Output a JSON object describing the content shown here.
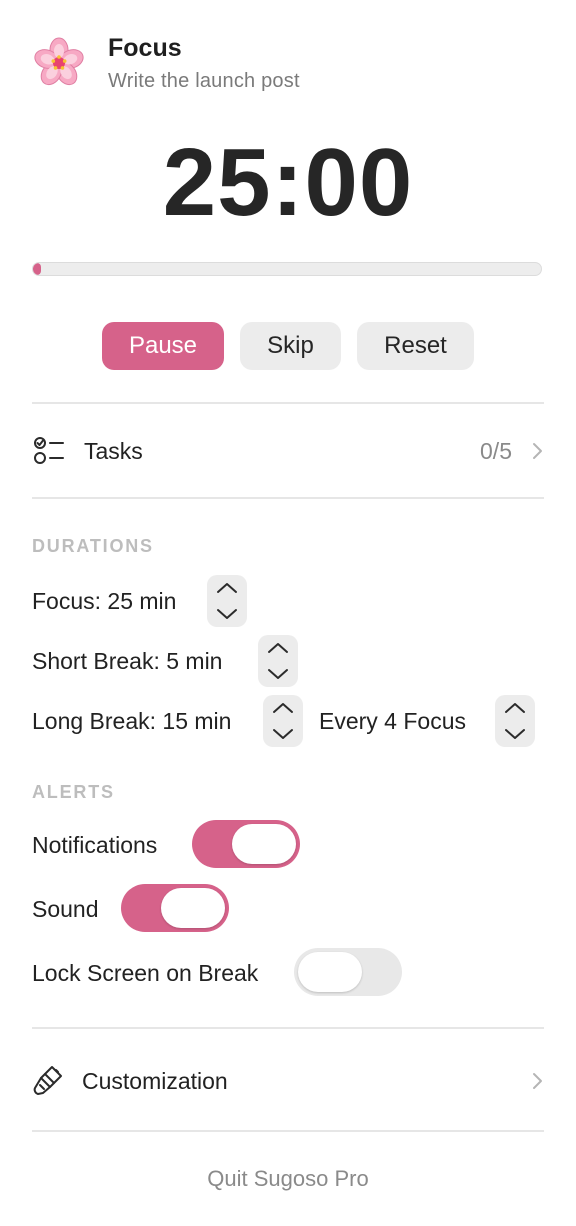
{
  "header": {
    "app_icon": "cherry-blossom-icon",
    "title": "Focus",
    "subtitle": "Write the launch post"
  },
  "timer": {
    "display": "25:00",
    "progress_fraction": 0.01
  },
  "controls": {
    "pause_label": "Pause",
    "skip_label": "Skip",
    "reset_label": "Reset"
  },
  "tasks": {
    "icon": "checklist-icon",
    "label": "Tasks",
    "count": "0/5",
    "chevron_icon": "chevron-right-icon"
  },
  "durations": {
    "header": "DURATIONS",
    "focus_label": "Focus: 25 min",
    "short_break_label": "Short Break: 5 min",
    "long_break_label": "Long Break: 15 min",
    "long_break_every_label": "Every 4 Focus"
  },
  "alerts": {
    "header": "ALERTS",
    "notifications": {
      "label": "Notifications",
      "enabled": true
    },
    "sound": {
      "label": "Sound",
      "enabled": true
    },
    "lock_screen": {
      "label": "Lock Screen on Break",
      "enabled": false
    }
  },
  "customization": {
    "icon": "paintbrush-icon",
    "label": "Customization",
    "chevron_icon": "chevron-right-icon"
  },
  "footer": {
    "quit_label": "Quit Sugoso Pro"
  },
  "colors": {
    "accent": "#d6628a",
    "track": "#ededed",
    "secondary_button": "#ececec",
    "muted_text": "#8a8a8a",
    "section_header": "#bdbdbd"
  }
}
